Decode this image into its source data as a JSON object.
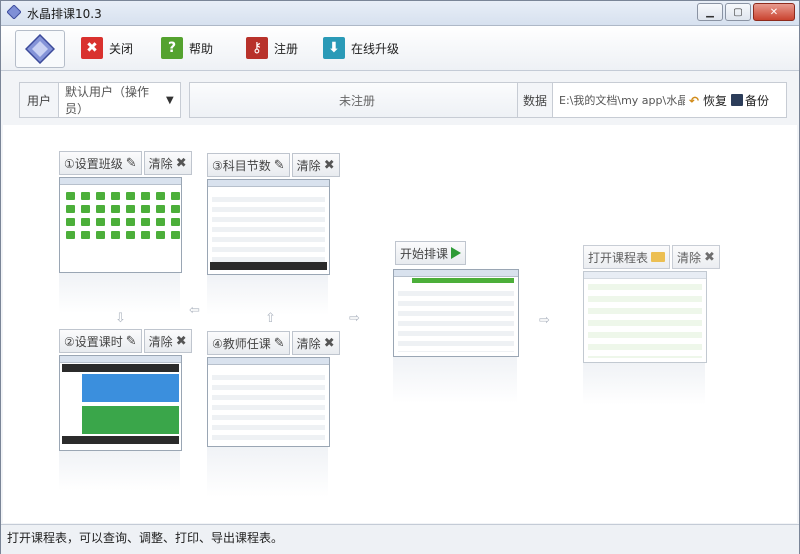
{
  "window": {
    "title": "水晶排课10.3"
  },
  "toolbar": {
    "close_label": "关闭",
    "help_label": "帮助",
    "register_label": "注册",
    "upgrade_label": "在线升级"
  },
  "controls": {
    "user_label": "用户",
    "user_value": "默认用户（操作员）",
    "register_status": "未注册",
    "data_label": "数据",
    "data_path": "E:\\我的文档\\my app\\水晶…",
    "restore_label": "恢复",
    "backup_label": "备份"
  },
  "steps": {
    "s1": "①设置班级",
    "s2": "②设置课时",
    "s3": "③科目节数",
    "s4": "④教师任课",
    "start": "开始排课",
    "open": "打开课程表",
    "clear": "清除"
  },
  "statusbar": {
    "text": "打开课程表，可以查询、调整、打印、导出课程表。"
  },
  "colors": {
    "close": "#d9312e",
    "help": "#54a22f",
    "register": "#b8322b",
    "upgrade": "#2a9ab7",
    "play": "#2f9b37"
  }
}
